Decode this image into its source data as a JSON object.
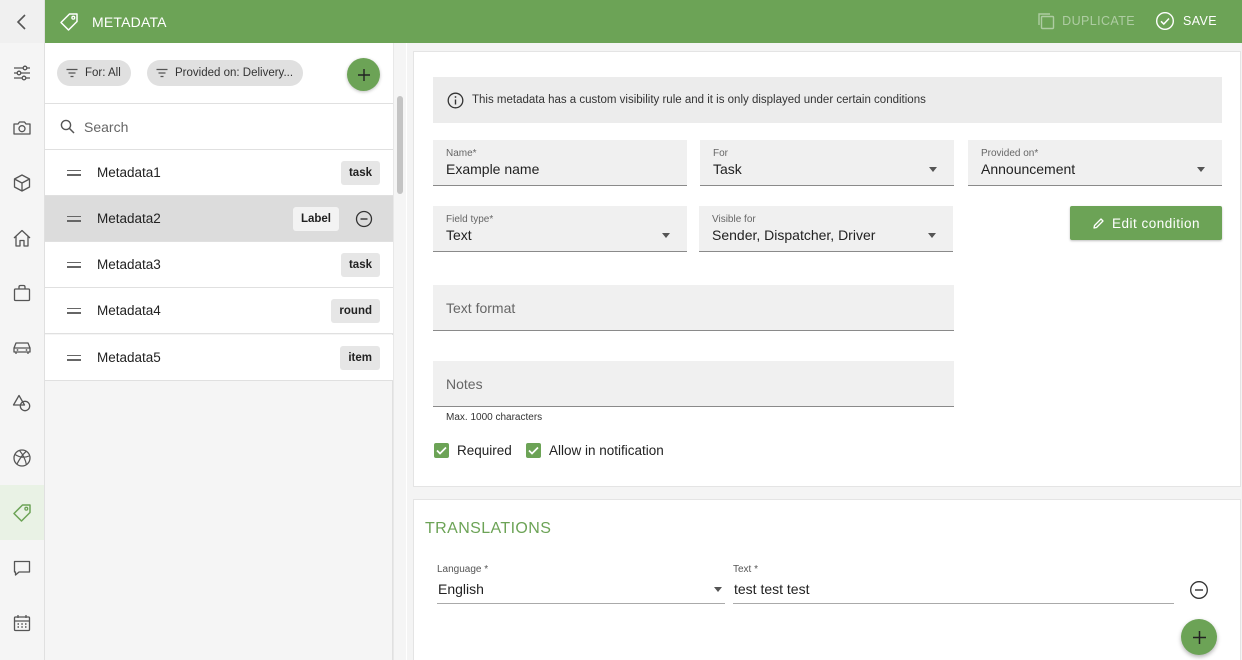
{
  "header": {
    "title": "METADATA",
    "duplicate_label": "DUPLICATE",
    "save_label": "SAVE",
    "accent_color": "#6ca356"
  },
  "nav": {
    "items": [
      "filters",
      "camera",
      "box",
      "home",
      "bag",
      "car",
      "shapes",
      "dribbble",
      "tag",
      "chat",
      "calendar"
    ],
    "active": "tag"
  },
  "filters": {
    "for_chip": "For: All",
    "provided_chip": "Provided on: Delivery..."
  },
  "search": {
    "placeholder": "Search"
  },
  "list": {
    "items": [
      {
        "label": "Metadata1",
        "tag": "task"
      },
      {
        "label": "Metadata2",
        "tag": "Label",
        "selected": true
      },
      {
        "label": "Metadata3",
        "tag": "task"
      },
      {
        "label": "Metadata4",
        "tag": "round"
      },
      {
        "label": "Metadata5",
        "tag": "item"
      }
    ]
  },
  "form": {
    "info_text": "This metadata has a custom visibility rule and it is only displayed under certain conditions",
    "name": {
      "label": "Name*",
      "value": "Example name"
    },
    "for": {
      "label": "For",
      "value": "Task"
    },
    "provided_on": {
      "label": "Provided on*",
      "value": "Announcement"
    },
    "field_type": {
      "label": "Field type*",
      "value": "Text"
    },
    "visible_for": {
      "label": "Visible for",
      "value": "Sender, Dispatcher, Driver"
    },
    "edit_condition_label": "Edit condition",
    "text_format": {
      "placeholder": "Text format"
    },
    "notes": {
      "placeholder": "Notes",
      "hint": "Max. 1000 characters"
    },
    "required_label": "Required",
    "required_checked": true,
    "allow_notification_label": "Allow in notification",
    "allow_notification_checked": true
  },
  "translations": {
    "title": "TRANSLATIONS",
    "language_label": "Language",
    "language_value": "English",
    "text_label": "Text",
    "text_value": "test test test"
  }
}
